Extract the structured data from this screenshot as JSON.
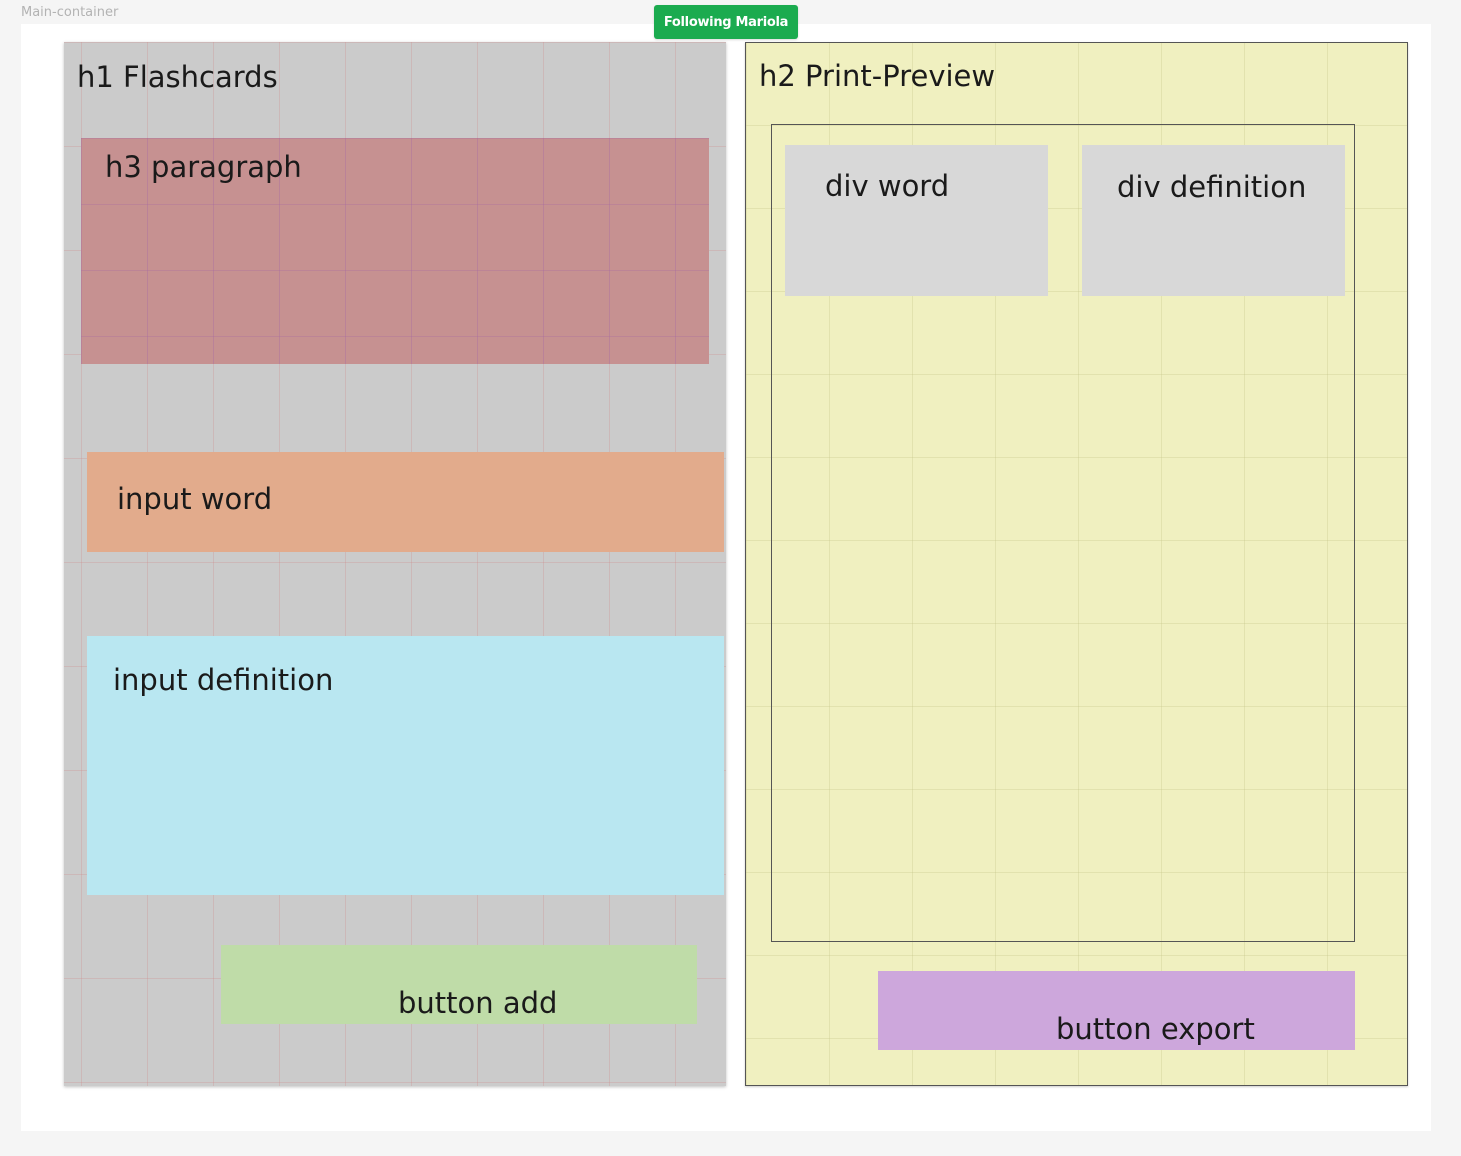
{
  "frame": {
    "label": "Main-container",
    "following_badge": "Following Mariola"
  },
  "left_panel": {
    "heading": "h1 Flashcards",
    "paragraph_block": "h3 paragraph",
    "input_word": "input word",
    "input_definition": "input definition",
    "button_add": "button add"
  },
  "right_panel": {
    "heading": "h2 Print-Preview",
    "div_word": "div word",
    "div_definition": "div definition",
    "button_export": "button export"
  },
  "colors": {
    "left_panel_bg": "#cbcbcb",
    "right_panel_bg": "#f0f0c0",
    "paragraph_bg": "#c69191",
    "input_word_bg": "#e2ab8c",
    "input_definition_bg": "#b9e7f1",
    "button_add_bg": "#bfdca8",
    "div_bg": "#d8d8d8",
    "button_export_bg": "#cda7dc",
    "badge_bg": "#1bab4f"
  }
}
